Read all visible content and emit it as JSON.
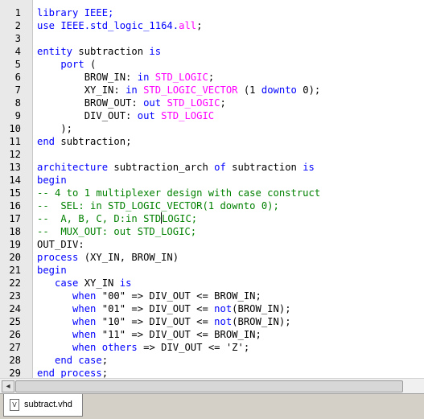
{
  "editor": {
    "lines": [
      {
        "n": "1",
        "t": [
          [
            "library IEEE;",
            "#0000ff"
          ]
        ]
      },
      {
        "n": "2",
        "t": [
          [
            "use IEEE.std_logic_1164.",
            "#0000ff"
          ],
          [
            "all",
            "#ff00ff"
          ],
          [
            ";",
            "#000000"
          ]
        ]
      },
      {
        "n": "3",
        "t": []
      },
      {
        "n": "4",
        "t": [
          [
            "entity",
            "#0000ff"
          ],
          [
            " subtraction ",
            "#000000"
          ],
          [
            "is",
            "#0000ff"
          ]
        ]
      },
      {
        "n": "5",
        "t": [
          [
            "    ",
            "#000000"
          ],
          [
            "port",
            "#0000ff"
          ],
          [
            " (",
            "#000000"
          ]
        ]
      },
      {
        "n": "6",
        "t": [
          [
            "        BROW_IN: ",
            "#000000"
          ],
          [
            "in",
            "#0000ff"
          ],
          [
            " ",
            "#000000"
          ],
          [
            "STD_LOGIC",
            "#ff00ff"
          ],
          [
            ";",
            "#000000"
          ]
        ]
      },
      {
        "n": "7",
        "t": [
          [
            "        XY_IN: ",
            "#000000"
          ],
          [
            "in",
            "#0000ff"
          ],
          [
            " ",
            "#000000"
          ],
          [
            "STD_LOGIC_VECTOR",
            "#ff00ff"
          ],
          [
            " (1 ",
            "#000000"
          ],
          [
            "downto",
            "#0000ff"
          ],
          [
            " 0);",
            "#000000"
          ]
        ]
      },
      {
        "n": "8",
        "t": [
          [
            "        BROW_OUT: ",
            "#000000"
          ],
          [
            "out",
            "#0000ff"
          ],
          [
            " ",
            "#000000"
          ],
          [
            "STD_LOGIC",
            "#ff00ff"
          ],
          [
            ";",
            "#000000"
          ]
        ]
      },
      {
        "n": "9",
        "t": [
          [
            "        DIV_OUT: ",
            "#000000"
          ],
          [
            "out",
            "#0000ff"
          ],
          [
            " ",
            "#000000"
          ],
          [
            "STD_LOGIC",
            "#ff00ff"
          ]
        ]
      },
      {
        "n": "10",
        "t": [
          [
            "    );",
            "#000000"
          ]
        ]
      },
      {
        "n": "11",
        "t": [
          [
            "end",
            "#0000ff"
          ],
          [
            " subtraction;",
            "#000000"
          ]
        ]
      },
      {
        "n": "12",
        "t": []
      },
      {
        "n": "13",
        "t": [
          [
            "architecture",
            "#0000ff"
          ],
          [
            " subtraction_arch ",
            "#000000"
          ],
          [
            "of",
            "#0000ff"
          ],
          [
            " subtraction ",
            "#000000"
          ],
          [
            "is",
            "#0000ff"
          ]
        ]
      },
      {
        "n": "14",
        "t": [
          [
            "begin",
            "#0000ff"
          ]
        ]
      },
      {
        "n": "15",
        "t": [
          [
            "-- 4 to 1 multiplexer design with case construct",
            "#008000"
          ]
        ]
      },
      {
        "n": "16",
        "t": [
          [
            "--  SEL: in STD_LOGIC_VECTOR(1 downto 0);",
            "#008000"
          ]
        ]
      },
      {
        "n": "17",
        "t": [
          [
            "--  A, B, C, D:in STD",
            "#008000"
          ],
          [
            "|",
            "caret"
          ],
          [
            "LOGIC;",
            "#008000"
          ]
        ]
      },
      {
        "n": "18",
        "t": [
          [
            "--  MUX_OUT: out STD_LOGIC;",
            "#008000"
          ]
        ]
      },
      {
        "n": "19",
        "t": [
          [
            "OUT_DIV:",
            "#000000"
          ]
        ]
      },
      {
        "n": "20",
        "t": [
          [
            "process",
            "#0000ff"
          ],
          [
            " (XY_IN, BROW_IN)",
            "#000000"
          ]
        ]
      },
      {
        "n": "21",
        "t": [
          [
            "begin",
            "#0000ff"
          ]
        ]
      },
      {
        "n": "22",
        "t": [
          [
            "   ",
            "#000000"
          ],
          [
            "case",
            "#0000ff"
          ],
          [
            " XY_IN ",
            "#000000"
          ],
          [
            "is",
            "#0000ff"
          ]
        ]
      },
      {
        "n": "23",
        "t": [
          [
            "      ",
            "#000000"
          ],
          [
            "when",
            "#0000ff"
          ],
          [
            " \"00\" => DIV_OUT <= BROW_IN;",
            "#000000"
          ]
        ]
      },
      {
        "n": "24",
        "t": [
          [
            "      ",
            "#000000"
          ],
          [
            "when",
            "#0000ff"
          ],
          [
            " \"01\" => DIV_OUT <= ",
            "#000000"
          ],
          [
            "not",
            "#0000ff"
          ],
          [
            "(BROW_IN);",
            "#000000"
          ]
        ]
      },
      {
        "n": "25",
        "t": [
          [
            "      ",
            "#000000"
          ],
          [
            "when",
            "#0000ff"
          ],
          [
            " \"10\" => DIV_OUT <= ",
            "#000000"
          ],
          [
            "not",
            "#0000ff"
          ],
          [
            "(BROW_IN);",
            "#000000"
          ]
        ]
      },
      {
        "n": "26",
        "t": [
          [
            "      ",
            "#000000"
          ],
          [
            "when",
            "#0000ff"
          ],
          [
            " \"11\" => DIV_OUT <= BROW_IN;",
            "#000000"
          ]
        ]
      },
      {
        "n": "27",
        "t": [
          [
            "      ",
            "#000000"
          ],
          [
            "when",
            "#0000ff"
          ],
          [
            " ",
            "#000000"
          ],
          [
            "others",
            "#0000ff"
          ],
          [
            " => DIV_OUT <= 'Z';",
            "#000000"
          ]
        ]
      },
      {
        "n": "28",
        "t": [
          [
            "   ",
            "#000000"
          ],
          [
            "end case",
            "#0000ff"
          ],
          [
            ";",
            "#000000"
          ]
        ]
      },
      {
        "n": "29",
        "t": [
          [
            "end process",
            "#0000ff"
          ],
          [
            ";",
            "#000000"
          ]
        ]
      }
    ]
  },
  "scrollbar": {
    "left_arrow_icon": "left-arrow-icon",
    "left_arrow_glyph": "◂"
  },
  "tabs": [
    {
      "label": "subtract.vhd",
      "icon": "vhdl-file-icon",
      "icon_glyph": "V"
    }
  ]
}
